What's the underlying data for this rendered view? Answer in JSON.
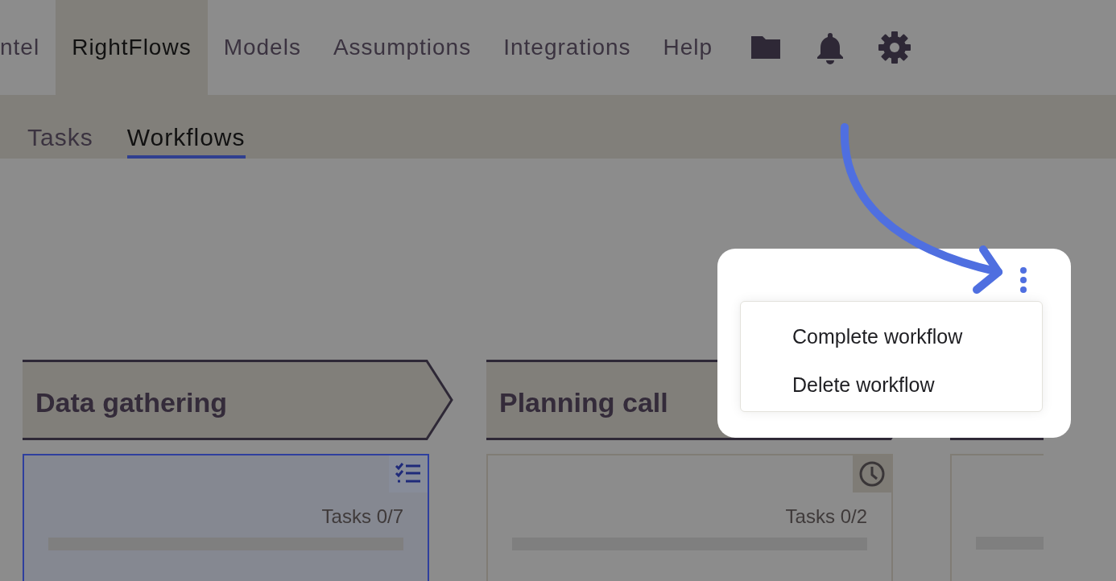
{
  "nav": {
    "items": [
      {
        "label": "ntel",
        "selected": false
      },
      {
        "label": "RightFlows",
        "selected": true
      },
      {
        "label": "Models",
        "selected": false
      },
      {
        "label": "Assumptions",
        "selected": false
      },
      {
        "label": "Integrations",
        "selected": false
      },
      {
        "label": "Help",
        "selected": false
      }
    ],
    "icons": [
      {
        "kind": "folder"
      },
      {
        "kind": "bell"
      },
      {
        "kind": "settings"
      }
    ]
  },
  "subtabs": [
    {
      "label": "Tasks",
      "selected": false
    },
    {
      "label": "Workflows",
      "selected": true
    }
  ],
  "stages": [
    {
      "title": "Data gathering",
      "kind": "checklist",
      "selected": true,
      "tasks": "Tasks 0/7",
      "level": 0
    },
    {
      "title": "Planning call",
      "kind": "clock",
      "selected": false,
      "tasks": "Tasks 0/2",
      "level": 0
    },
    {
      "selected": false,
      "level": 0
    }
  ],
  "menu": {
    "items": [
      "Complete workflow",
      "Delete workflow"
    ]
  }
}
